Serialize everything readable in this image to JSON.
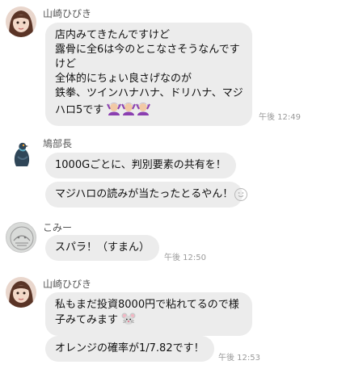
{
  "messages": [
    {
      "sender": "山崎ひびき",
      "lines": [
        "店内みてきたんですけど",
        "露骨に全6は今のとこなさそうなんです",
        "けど",
        "全体的にちょい良さげなのが",
        "鉄拳、ツインハナハナ、ドリハナ、マジ",
        "ハロ5です"
      ],
      "emoji": "woman-gesturing-icon",
      "time": "午後 12:49"
    },
    {
      "sender": "鳩部長",
      "bubbles": [
        "1000Gごとに、判別要素の共有を！",
        "マジハロの読みが当たったとるやん！"
      ],
      "reaction_icon": "smiley-reaction-icon"
    },
    {
      "sender": "こみー",
      "bubbles": [
        "スパラ！（すまん）"
      ],
      "time": "午後 12:50"
    },
    {
      "sender": "山崎ひびき",
      "lines": [
        "私もまだ投資8000円で粘れてるので様",
        "子みてみます"
      ],
      "emoji": "mouse-face-icon",
      "bubbles": [
        "オレンジの確率が1/7.82です！"
      ],
      "time": "午後 12:53"
    }
  ]
}
